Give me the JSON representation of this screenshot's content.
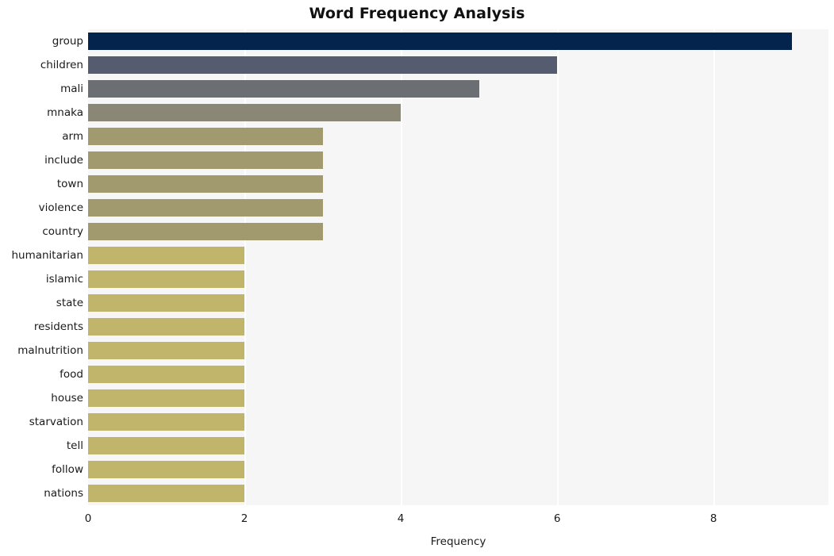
{
  "chart_data": {
    "type": "bar",
    "orientation": "horizontal",
    "title": "Word Frequency Analysis",
    "xlabel": "Frequency",
    "ylabel": "",
    "categories": [
      "group",
      "children",
      "mali",
      "mnaka",
      "arm",
      "include",
      "town",
      "violence",
      "country",
      "humanitarian",
      "islamic",
      "state",
      "residents",
      "malnutrition",
      "food",
      "house",
      "starvation",
      "tell",
      "follow",
      "nations"
    ],
    "values": [
      9,
      6,
      5,
      4,
      3,
      3,
      3,
      3,
      3,
      2,
      2,
      2,
      2,
      2,
      2,
      2,
      2,
      2,
      2,
      2
    ],
    "bar_colors": [
      "#04244d",
      "#555c70",
      "#6b6e72",
      "#8a8777",
      "#a09a6e",
      "#a09a6e",
      "#a09a6e",
      "#a09a6e",
      "#a09a6e",
      "#c1b46b",
      "#c1b46b",
      "#c1b46b",
      "#c1b46b",
      "#c1b46b",
      "#c1b46b",
      "#c1b46b",
      "#c1b46b",
      "#c1b46b",
      "#c1b46b",
      "#c1b46b"
    ],
    "xlim": [
      0,
      9.47
    ],
    "xticks": [
      0,
      2,
      4,
      6,
      8
    ],
    "xtick_labels": [
      "0",
      "2",
      "4",
      "6",
      "8"
    ],
    "grid": "vertical",
    "gridline_color": "#ffffff",
    "plot_background": "#f6f6f7",
    "figure_background": "#ffffff",
    "legend": null
  }
}
